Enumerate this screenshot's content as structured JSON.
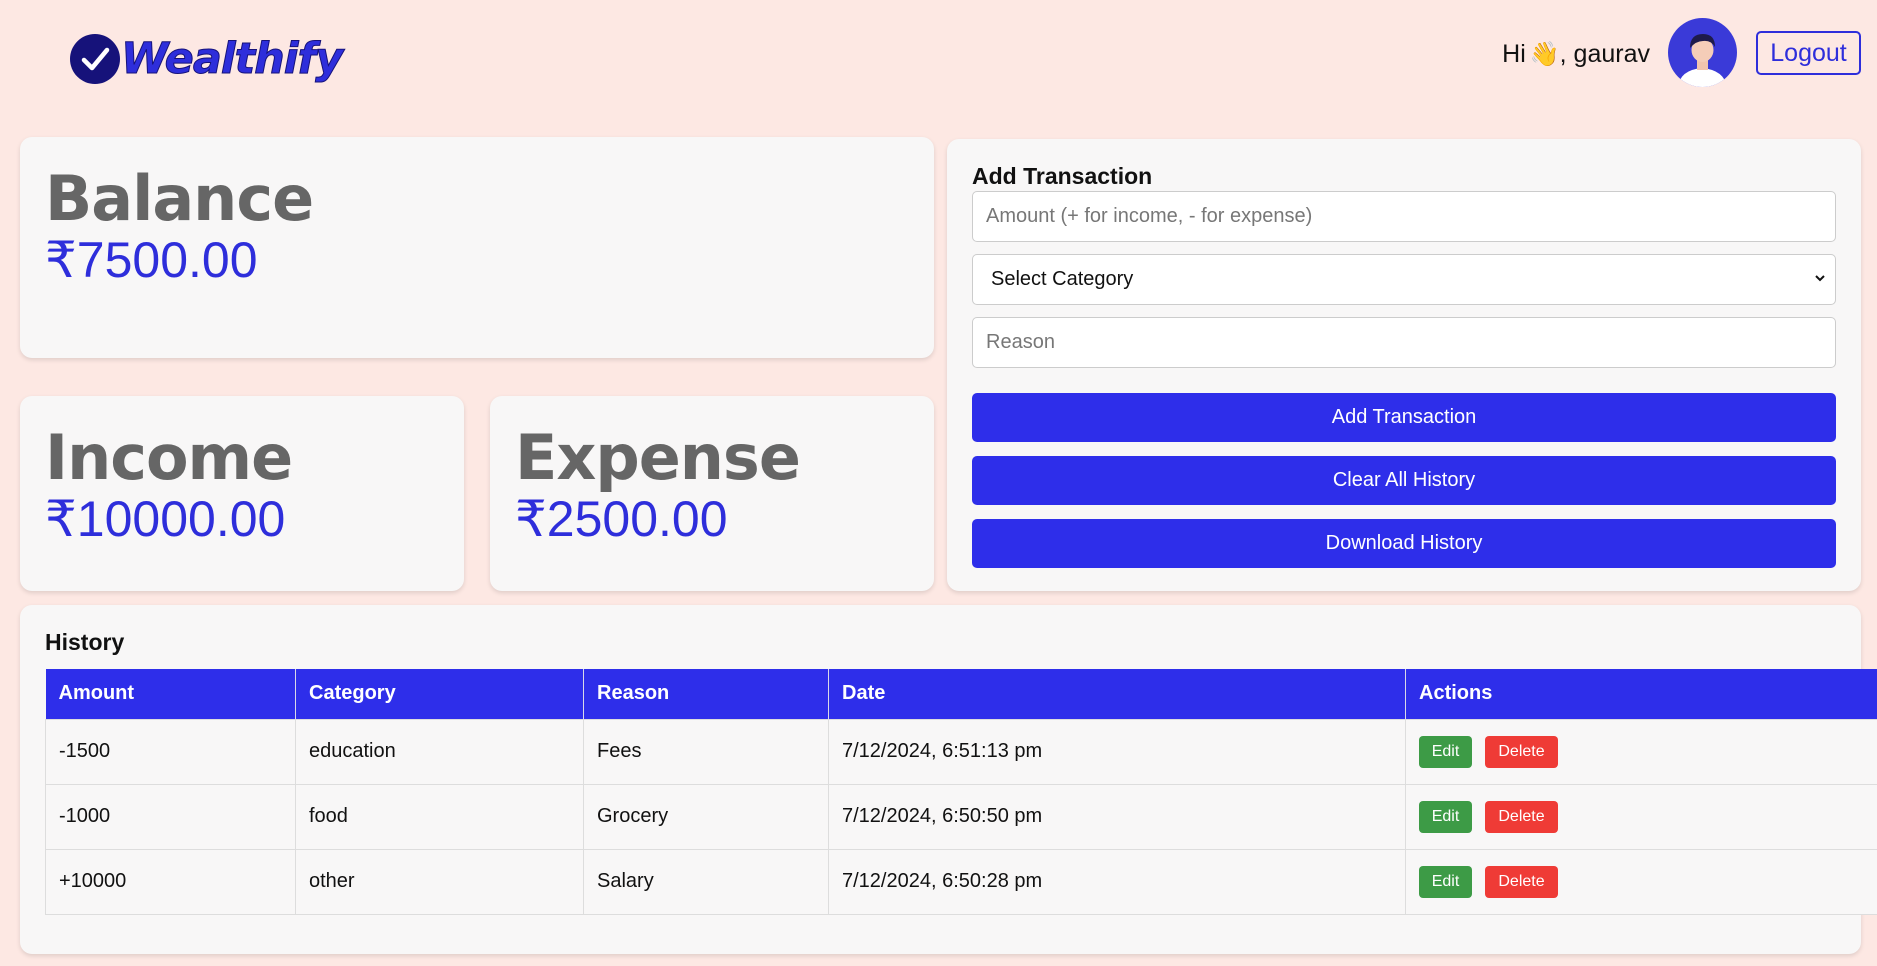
{
  "header": {
    "brand": "Wealthify",
    "greeting_prefix": "Hi",
    "greeting_emoji": "👋",
    "greeting_name": ", gaurav",
    "logout_label": "Logout"
  },
  "balance": {
    "title": "Balance",
    "value": "₹7500.00"
  },
  "income": {
    "title": "Income",
    "value": "₹10000.00"
  },
  "expense": {
    "title": "Expense",
    "value": "₹2500.00"
  },
  "add_transaction": {
    "title": "Add Transaction",
    "amount_placeholder": "Amount (+ for income, - for expense)",
    "category_selected": "Select Category",
    "reason_placeholder": "Reason",
    "add_button": "Add Transaction",
    "clear_button": "Clear All History",
    "download_button": "Download History"
  },
  "history": {
    "title": "History",
    "columns": [
      "Amount",
      "Category",
      "Reason",
      "Date",
      "Actions"
    ],
    "rows": [
      {
        "amount": "-1500",
        "category": "education",
        "reason": "Fees",
        "date": "7/12/2024, 6:51:13 pm"
      },
      {
        "amount": "-1000",
        "category": "food",
        "reason": "Grocery",
        "date": "7/12/2024, 6:50:50 pm"
      },
      {
        "amount": "+10000",
        "category": "other",
        "reason": "Salary",
        "date": "7/12/2024, 6:50:28 pm"
      }
    ],
    "edit_label": "Edit",
    "delete_label": "Delete"
  },
  "icons": {
    "logo": "check-circle-icon",
    "avatar": "user-avatar",
    "select": "chevron-down-icon"
  },
  "colors": {
    "accent": "#2e2eea",
    "background": "#fde8e3",
    "edit": "#3d9b46",
    "delete": "#ef3b36"
  }
}
